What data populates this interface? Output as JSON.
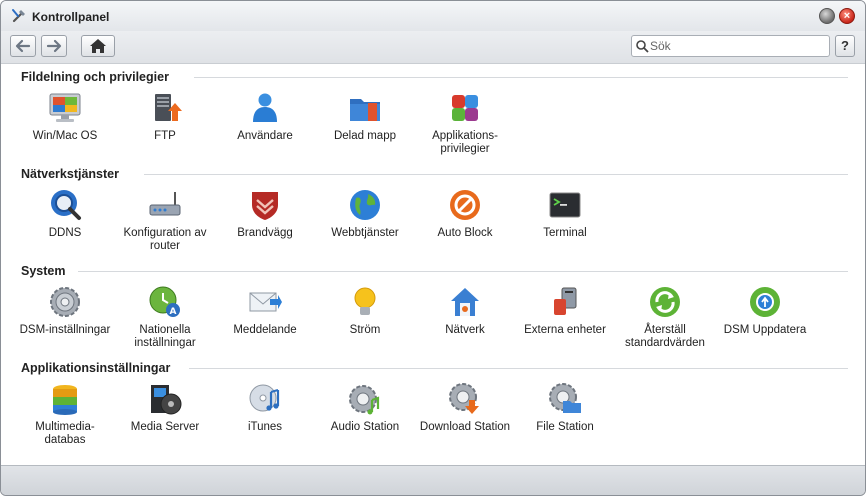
{
  "window": {
    "title": "Kontrollpanel"
  },
  "toolbar": {
    "search_placeholder": "Sök",
    "help_label": "?"
  },
  "sections": [
    {
      "title": "Fildelning och privilegier",
      "items": [
        {
          "label": "Win/Mac OS",
          "icon": "win-mac-icon"
        },
        {
          "label": "FTP",
          "icon": "ftp-icon"
        },
        {
          "label": "Användare",
          "icon": "user-icon"
        },
        {
          "label": "Delad mapp",
          "icon": "shared-folder-icon"
        },
        {
          "label": "Applikations-privilegier",
          "icon": "app-privileges-icon"
        }
      ]
    },
    {
      "title": "Nätverkstjänster",
      "items": [
        {
          "label": "DDNS",
          "icon": "ddns-icon"
        },
        {
          "label": "Konfiguration av router",
          "icon": "router-icon"
        },
        {
          "label": "Brandvägg",
          "icon": "firewall-icon"
        },
        {
          "label": "Webbtjänster",
          "icon": "web-services-icon"
        },
        {
          "label": "Auto Block",
          "icon": "auto-block-icon"
        },
        {
          "label": "Terminal",
          "icon": "terminal-icon"
        }
      ]
    },
    {
      "title": "System",
      "items": [
        {
          "label": "DSM-inställningar",
          "icon": "dsm-settings-icon"
        },
        {
          "label": "Nationella inställningar",
          "icon": "regional-settings-icon"
        },
        {
          "label": "Meddelande",
          "icon": "notification-icon"
        },
        {
          "label": "Ström",
          "icon": "power-icon"
        },
        {
          "label": "Nätverk",
          "icon": "network-icon"
        },
        {
          "label": "Externa enheter",
          "icon": "external-devices-icon"
        },
        {
          "label": "Återställ standardvärden",
          "icon": "restore-defaults-icon"
        },
        {
          "label": "DSM Uppdatera",
          "icon": "dsm-update-icon"
        }
      ]
    },
    {
      "title": "Applikationsinställningar",
      "items": [
        {
          "label": "Multimedia-databas",
          "icon": "media-database-icon"
        },
        {
          "label": "Media Server",
          "icon": "media-server-icon"
        },
        {
          "label": "iTunes",
          "icon": "itunes-icon"
        },
        {
          "label": "Audio Station",
          "icon": "audio-station-icon"
        },
        {
          "label": "Download Station",
          "icon": "download-station-icon"
        },
        {
          "label": "File Station",
          "icon": "file-station-icon"
        }
      ]
    }
  ]
}
